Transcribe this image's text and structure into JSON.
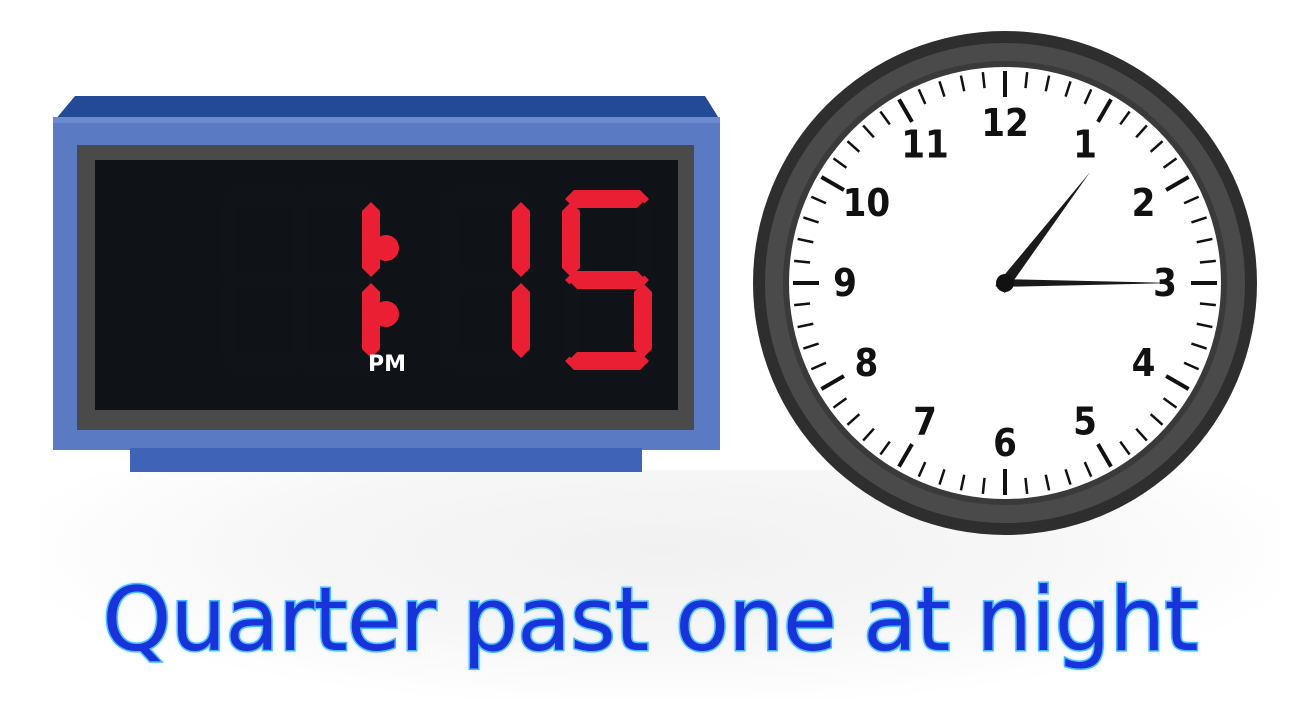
{
  "digital_clock": {
    "hour": "1",
    "colon": ":",
    "minutes": "15",
    "period": "PM",
    "digit_color": "#ea1f33",
    "case_color": "#5a7bc4"
  },
  "analog_clock": {
    "numbers": [
      "12",
      "1",
      "2",
      "3",
      "4",
      "5",
      "6",
      "7",
      "8",
      "9",
      "10",
      "11"
    ],
    "time": {
      "hour": 1,
      "minute": 15
    },
    "face_color": "#ffffff",
    "rim_color": "#3a3a3a"
  },
  "caption": "Quarter past one at night"
}
